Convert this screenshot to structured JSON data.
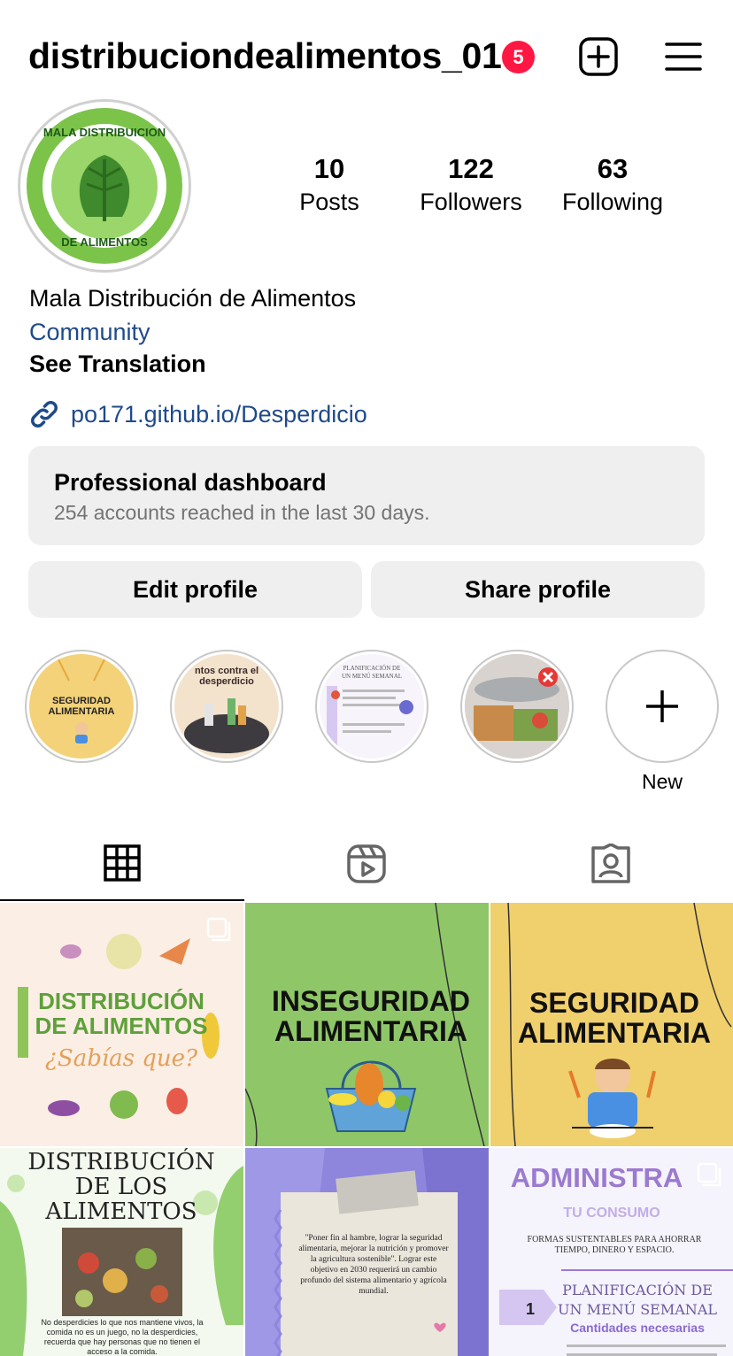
{
  "header": {
    "username": "distribuciondealimentos_01",
    "notification_count": "5",
    "add_icon": "plus-square-icon",
    "menu_icon": "hamburger-menu-icon"
  },
  "profile": {
    "avatar_text_top": "MALA DISTRIBUICION",
    "avatar_text_bottom": "DE ALIMENTOS",
    "stats": {
      "posts_count": "10",
      "posts_label": "Posts",
      "followers_count": "122",
      "followers_label": "Followers",
      "following_count": "63",
      "following_label": "Following"
    },
    "name": "Mala Distribución de Alimentos",
    "category": "Community",
    "see_translation": "See Translation",
    "link": "po171.github.io/Desperdicio"
  },
  "dashboard": {
    "title": "Professional dashboard",
    "subtitle": "254 accounts reached in the last 30 days."
  },
  "buttons": {
    "edit": "Edit profile",
    "share": "Share profile"
  },
  "highlights": {
    "h1_text": "SEGURIDAD ALIMENTARIA",
    "h2_text": "ntos contra el desperdicio",
    "h3_text": "PLANIFICACIÓN DE UN MENÚ SEMANAL",
    "new_label": "New"
  },
  "tabs": [
    "grid-icon",
    "reels-icon",
    "tagged-icon"
  ],
  "posts": [
    {
      "line1": "DISTRIBUCIÓN",
      "line2": "DE ALIMENTOS",
      "line3": "¿Sabías que?"
    },
    {
      "line1": "INSEGURIDAD",
      "line2": "ALIMENTARIA"
    },
    {
      "line1": "SEGURIDAD",
      "line2": "ALIMENTARIA"
    },
    {
      "line1": "DISTRIBUCIÓN",
      "line2": "DE LOS",
      "line3": "ALIMENTOS",
      "caption": "No desperdicies lo que nos mantiene vivos, la comida no es un juego, no la desperdicies, recuerda que hay personas que no tienen el acceso a la comida."
    },
    {
      "quote": "\"Poner fin al hambre, lograr la seguridad alimentaria, mejorar la nutrición y promover la agricultura sostenible\". Lograr este objetivo en 2030 requerirá un cambio profundo del sistema alimentario y agrícola mundial."
    },
    {
      "line1": "ADMINISTRA",
      "line2": "TU CONSUMO",
      "line3": "FORMAS SUSTENTABLES PARA AHORRAR TIEMPO, DINERO Y ESPACIO.",
      "line4": "PLANIFICACIÓN DE",
      "line5": "UN MENÚ SEMANAL",
      "line6": "Cantidades necesarias",
      "number": "1"
    }
  ],
  "colors": {
    "link_blue": "#1f4a8a",
    "badge_red": "#ff1744",
    "button_gray": "#efefef"
  }
}
